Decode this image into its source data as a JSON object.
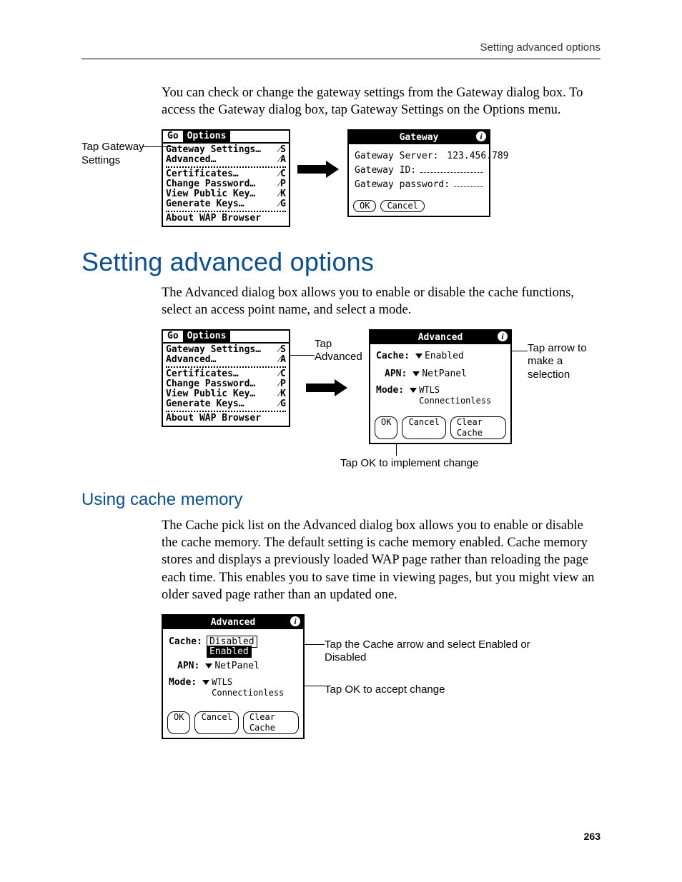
{
  "running_head": "Setting advanced options",
  "intro_paragraph": "You can check or change the gateway settings from the Gateway dialog box. To access the Gateway dialog box, tap Gateway Settings on the Options menu.",
  "fig1": {
    "callout_left": "Tap Gateway Settings",
    "menubar_tabs": [
      "Go",
      "Options"
    ],
    "menu_items": [
      {
        "label": "Gateway Settings…",
        "short": "⁄S"
      },
      {
        "label": "Advanced…",
        "short": "⁄A"
      },
      {
        "sep": true
      },
      {
        "label": "Certificates…",
        "short": "⁄C"
      },
      {
        "label": "Change Password…",
        "short": "⁄P"
      },
      {
        "label": "View Public Key…",
        "short": "⁄K"
      },
      {
        "label": "Generate Keys…",
        "short": "⁄G"
      },
      {
        "sep": true
      },
      {
        "label": "About WAP Browser",
        "short": ""
      }
    ],
    "gateway_dialog": {
      "title": "Gateway",
      "rows": [
        {
          "label": "Gateway Server:",
          "value": "123.456.789"
        },
        {
          "label": "Gateway ID:",
          "value": ""
        },
        {
          "label": "Gateway password:",
          "value": ""
        }
      ],
      "buttons": [
        "OK",
        "Cancel"
      ]
    }
  },
  "section_title": "Setting advanced options",
  "section_intro": "The Advanced dialog box allows you to enable or disable the cache functions, select an access point name, and select a mode.",
  "fig2": {
    "callout_mid": "Tap Advanced",
    "callout_right": "Tap arrow to make a selection",
    "advanced_dialog": {
      "title": "Advanced",
      "cache_label": "Cache:",
      "cache_value": "Enabled",
      "apn_label": "APN:",
      "apn_value": "NetPanel",
      "mode_label": "Mode:",
      "mode_value": "WTLS Connectionless",
      "buttons": [
        "OK",
        "Cancel",
        "Clear Cache"
      ]
    },
    "caption_below": "Tap OK to implement change"
  },
  "subsection_title": "Using cache memory",
  "cache_paragraph": "The Cache pick list on the Advanced dialog box allows you to enable or disable the cache memory. The default setting is cache memory enabled. Cache memory stores and displays a previously loaded WAP page rather than reloading the page each time. This enables you to save time in viewing pages, but you might view an older saved page rather than an updated one.",
  "fig3": {
    "advanced_dialog": {
      "title": "Advanced",
      "cache_label": "Cache:",
      "cache_selected": "Disabled",
      "cache_popup": "Enabled",
      "apn_label": "APN:",
      "apn_value": "NetPanel",
      "mode_label": "Mode:",
      "mode_value": "WTLS Connectionless",
      "buttons": [
        "OK",
        "Cancel",
        "Clear Cache"
      ]
    },
    "callout1": "Tap the Cache arrow and select Enabled or Disabled",
    "callout2": "Tap OK to accept change"
  },
  "page_number": "263"
}
